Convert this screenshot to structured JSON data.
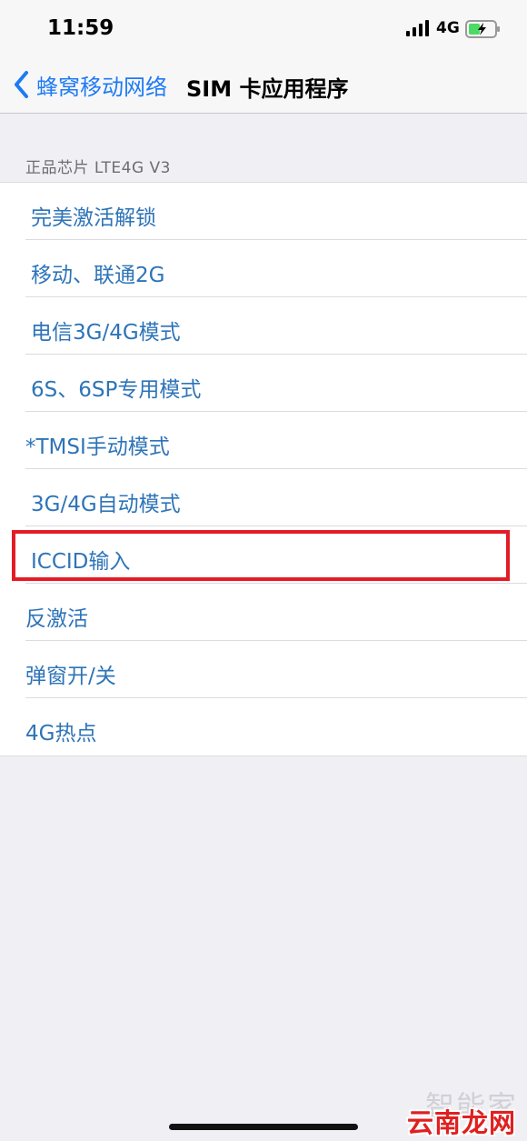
{
  "status_bar": {
    "time": "11:59",
    "network": "4G",
    "icons": [
      "signal-icon",
      "battery-charging-icon"
    ]
  },
  "nav": {
    "back_label": "蜂窝移动网络",
    "title": "SIM 卡应用程序",
    "back_icon": "chevron-left-icon"
  },
  "section": {
    "header": "正品芯片 LTE4G V3"
  },
  "items": [
    {
      "label": "完美激活解锁"
    },
    {
      "label": "移动、联通2G"
    },
    {
      "label": "电信3G/4G模式"
    },
    {
      "label": "6S、6SP专用模式"
    },
    {
      "label": "*TMSI手动模式"
    },
    {
      "label": "3G/4G自动模式"
    },
    {
      "label": "ICCID输入"
    },
    {
      "label": "反激活"
    },
    {
      "label": "弹窗开/关"
    },
    {
      "label": "4G热点"
    }
  ],
  "watermark": {
    "top": "智能家",
    "bottom": "云南龙网"
  },
  "colors": {
    "accent": "#1e7af5",
    "item_text": "#2e74b8",
    "highlight": "#e31c25",
    "background": "#efeff4"
  }
}
